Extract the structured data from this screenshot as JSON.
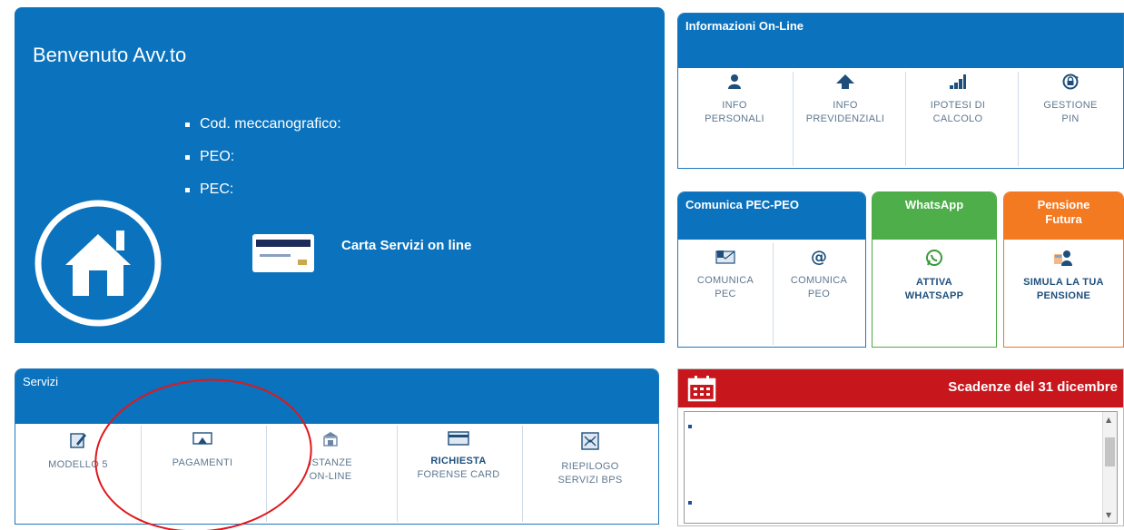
{
  "welcome": {
    "title": "Benvenuto Avv.to",
    "fields": [
      "Cod. meccanografico:",
      "PEO:",
      "PEC:"
    ],
    "card_label": "Carta Servizi on line",
    "house_icon": "house-icon",
    "card_icon": "credit-card-icon"
  },
  "info_online": {
    "title": "Informazioni On-Line",
    "items": [
      {
        "line1": "INFO",
        "line2": "PERSONALI",
        "icon": "person-icon"
      },
      {
        "line1": "INFO",
        "line2": "PREVIDENZIALI",
        "icon": "up-arrow-icon"
      },
      {
        "line1": "IPOTESI DI",
        "line2": "CALCOLO",
        "icon": "bar-chart-icon"
      },
      {
        "line1": "GESTIONE",
        "line2": "PIN",
        "icon": "lock-refresh-icon"
      }
    ]
  },
  "comunica": {
    "title": "Comunica PEC-PEO",
    "items": [
      {
        "line1": "COMUNICA",
        "line2": "PEC",
        "icon": "pec-mail-icon"
      },
      {
        "line1": "COMUNICA",
        "line2": "PEO",
        "icon": "at-icon"
      }
    ]
  },
  "whatsapp": {
    "title": "WhatsApp",
    "line1": "ATTIVA",
    "line2": "WHATSAPP",
    "icon": "whatsapp-icon",
    "color": "#4dae4a"
  },
  "pensione": {
    "title_line1": "Pensione",
    "title_line2": "Futura",
    "line1": "SIMULA LA TUA",
    "line2": "PENSIONE",
    "icon": "person-calculator-icon",
    "color": "#f47a22"
  },
  "servizi": {
    "title": "Servizi",
    "items": [
      {
        "line1": "MODELLO 5",
        "line2": "",
        "icon": "form-edit-icon"
      },
      {
        "line1": "PAGAMENTI",
        "line2": "",
        "icon": "payment-icon"
      },
      {
        "line1": "ISTANZE",
        "line2": "ON-LINE",
        "icon": "building-icon"
      },
      {
        "line1": "RICHIESTA",
        "line2": "FORENSE CARD",
        "icon": "card-icon"
      },
      {
        "line1": "RIEPILOGO",
        "line2": "SERVIZI BPS",
        "icon": "summary-icon"
      }
    ]
  },
  "scadenze": {
    "title": "Scadenze del 31 dicembre",
    "icon": "calendar-icon",
    "color": "#c8161d"
  },
  "colors": {
    "brand_blue": "#0b72bd",
    "annotation_red": "#e0171c"
  }
}
